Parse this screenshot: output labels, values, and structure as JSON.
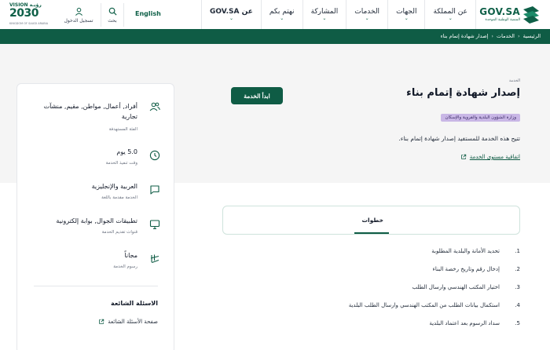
{
  "header": {
    "logo_text": "GOV.SA",
    "logo_subtitle": "المنصة الوطنية الموحدة",
    "nav": [
      {
        "label": "عن المملكة"
      },
      {
        "label": "الجهات"
      },
      {
        "label": "الخدمات"
      },
      {
        "label": "المشاركة"
      },
      {
        "label": "نهتم بكم"
      },
      {
        "label": "عن GOV.SA"
      }
    ],
    "language": "English",
    "search_label": "بحث",
    "login_label": "تسجيل الدخول",
    "vision_top": "VISION رؤيـة",
    "vision_year": "2030",
    "vision_sub": "KINGDOM OF SAUDI ARABIA"
  },
  "breadcrumb": {
    "items": [
      "الرئيسية",
      "الخدمات",
      "إصدار شهادة إتمام بناء"
    ],
    "separator": "‹"
  },
  "service": {
    "category": "الخدمة",
    "title": "إصدار شهادة إتمام بناء",
    "start_button": "ابدأ الخدمة",
    "ministry": "وزارة الشؤون البلدية والقروية والإسكان",
    "description": "تتيح هذه الخدمة للمستفيد إصدار شهادة إتمام بناء.",
    "sla_link": "اتفاقية مستوى الخدمة"
  },
  "info": [
    {
      "icon": "users-icon",
      "value": "أفراد, أعمال, مواطن, مقيم, منشآت تجارية",
      "key": "الفئة المستهدفة"
    },
    {
      "icon": "clock-icon",
      "value": "5.0 يوم",
      "key": "وقت تنفيذ الخدمة"
    },
    {
      "icon": "chat-icon",
      "value": "العربية والإنجليزية",
      "key": "الخدمة مقدمة باللغة"
    },
    {
      "icon": "monitor-icon",
      "value": "تطبيقات الجوال, بوابة إلكترونية",
      "key": "قنوات تقديم الخدمة"
    },
    {
      "icon": "riyal-icon",
      "value": "مجاناً",
      "key": "رسوم الخدمة"
    }
  ],
  "faq": {
    "title": "الاسئلة الشائعة",
    "link": "صفحة الأسئلة الشائعة"
  },
  "tabs": {
    "active": "خطوات"
  },
  "steps": [
    {
      "num": "1.",
      "text": "تحديد الأمانة والبلدية المطلوبة"
    },
    {
      "num": "2.",
      "text": "إدخال رقم وتاريخ رخصة البناء"
    },
    {
      "num": "3.",
      "text": "اختيار المكتب الهندسي وارسال الطلب"
    },
    {
      "num": "4.",
      "text": "استكمال بيانات الطلب من المكتب الهندسي وارسال الطلب البلدية"
    },
    {
      "num": "5.",
      "text": "سداد الرسوم بعد اعتماد البلدية"
    }
  ],
  "colors": {
    "primary": "#0f5c45",
    "hero_bg": "#f5f5f5",
    "ministry_badge": "#c9b7e6"
  }
}
